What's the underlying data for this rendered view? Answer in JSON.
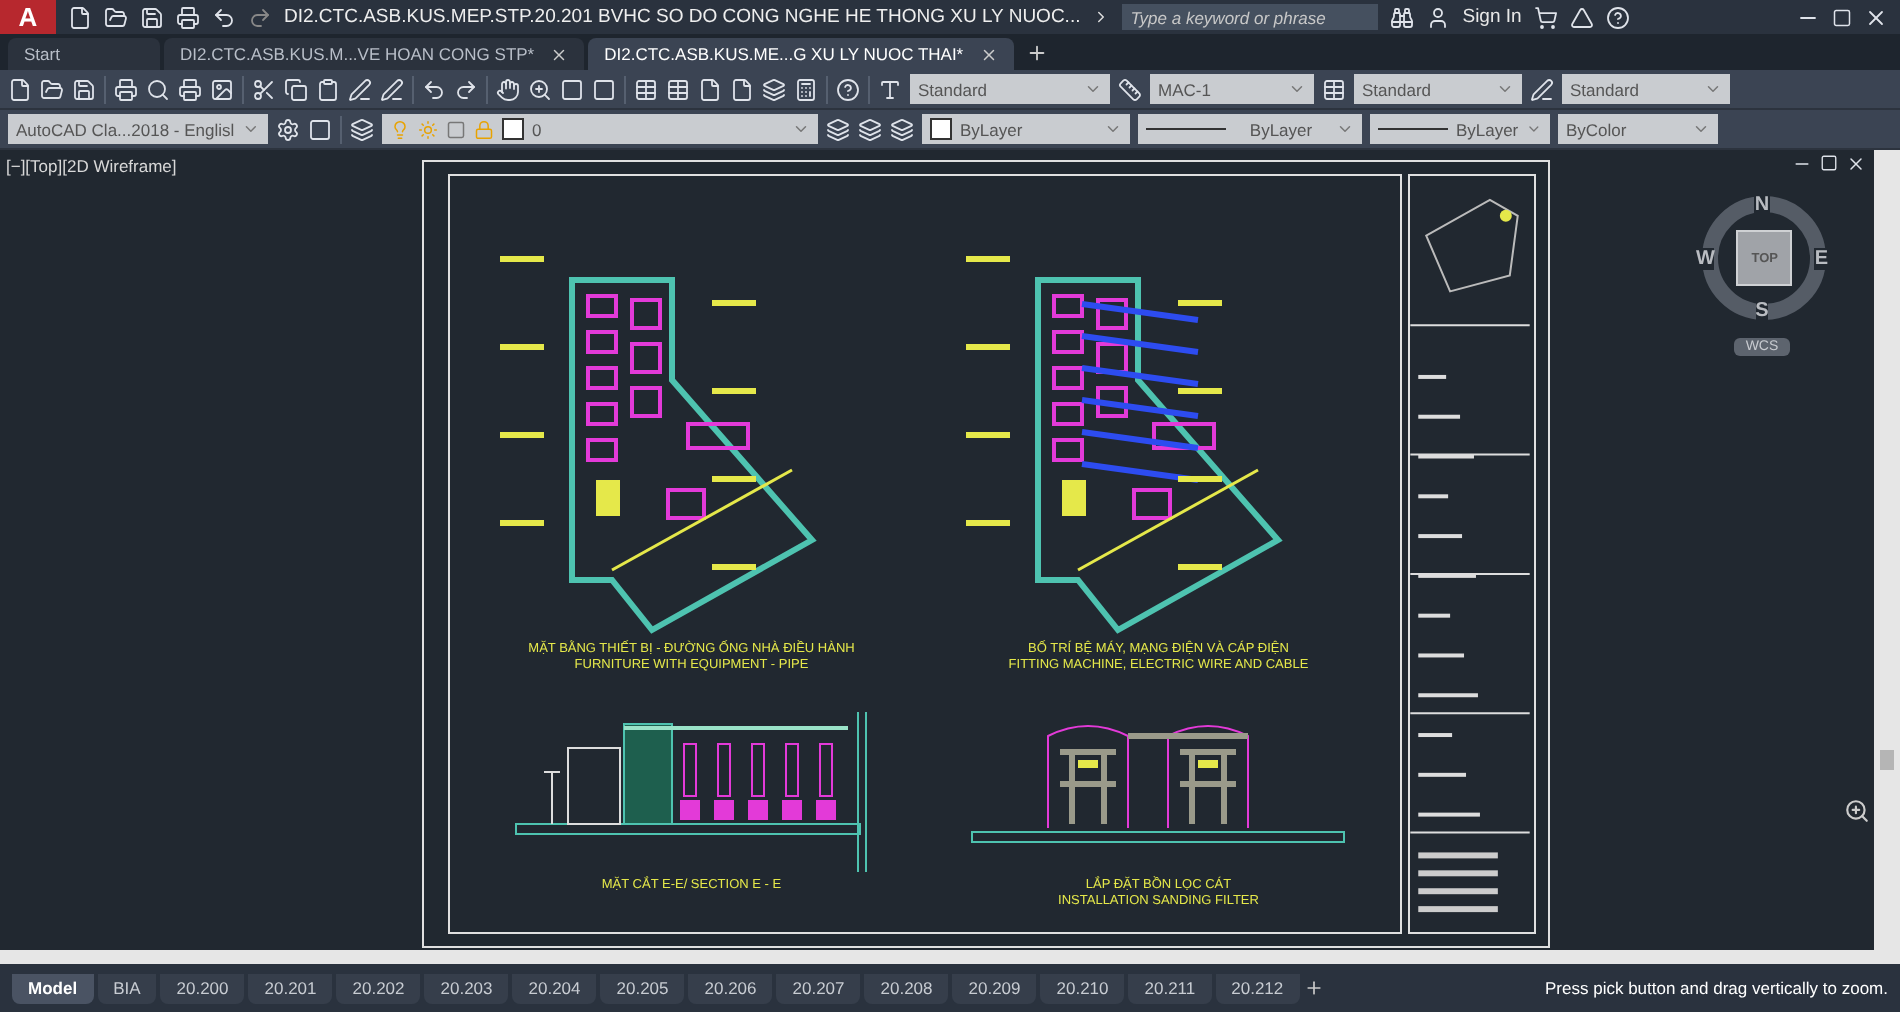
{
  "app": {
    "logo": "A",
    "title": "DI2.CTC.ASB.KUS.MEP.STP.20.201 BVHC SO DO CONG NGHE HE THONG XU LY NUOC...",
    "search": {
      "placeholder": "Type a keyword or phrase"
    },
    "sign_in": "Sign In"
  },
  "file_tabs": [
    {
      "label": "Start",
      "selected": false
    },
    {
      "label": "DI2.CTC.ASB.KUS.M...VE HOAN CONG STP*",
      "selected": false
    },
    {
      "label": "DI2.CTC.ASB.KUS.ME...G XU LY NUOC THAI*",
      "selected": true
    }
  ],
  "toolbar": {
    "text_style": "Standard",
    "dim_style": "MAC-1",
    "table_style": "Standard",
    "mleader_style": "Standard"
  },
  "properties_bar": {
    "workspace": "AutoCAD Cla...2018 - Englisl",
    "layer": "0",
    "color_value": "ByLayer",
    "linetype": "ByLayer",
    "lineweight": "ByLayer",
    "plot_style": "ByColor"
  },
  "viewport": {
    "label": "[−][Top][2D Wireframe]"
  },
  "viewcube": {
    "north": "N",
    "south": "S",
    "east": "E",
    "west": "W",
    "face": "TOP",
    "ucs": "WCS"
  },
  "drawing": {
    "captions": [
      {
        "lines": [
          "MẶT BẰNG THIẾT BỊ - ĐƯỜNG ỐNG NHÀ ĐIỀU HÀNH",
          "FURNITURE WITH EQUIPMENT - PIPE"
        ]
      },
      {
        "lines": [
          "BỐ TRÍ BỆ MÁY, MẠNG ĐIỆN VÀ CÁP ĐIỆN",
          "FITTING MACHINE, ELECTRIC WIRE AND CABLE"
        ]
      },
      {
        "lines": [
          "MẶT CẮT E-E/ SECTION E - E"
        ]
      },
      {
        "lines": [
          "LẮP ĐẶT BỒN LỌC CÁT",
          "INSTALLATION SANDING FILTER"
        ]
      }
    ]
  },
  "layout_tabs": [
    {
      "label": "Model",
      "selected": true
    },
    {
      "label": "BIA",
      "selected": false
    },
    {
      "label": "20.200",
      "selected": false
    },
    {
      "label": "20.201",
      "selected": false
    },
    {
      "label": "20.202",
      "selected": false
    },
    {
      "label": "20.203",
      "selected": false
    },
    {
      "label": "20.204",
      "selected": false
    },
    {
      "label": "20.205",
      "selected": false
    },
    {
      "label": "20.206",
      "selected": false
    },
    {
      "label": "20.207",
      "selected": false
    },
    {
      "label": "20.208",
      "selected": false
    },
    {
      "label": "20.209",
      "selected": false
    },
    {
      "label": "20.210",
      "selected": false
    },
    {
      "label": "20.211",
      "selected": false
    },
    {
      "label": "20.212",
      "selected": false
    }
  ],
  "status": "Press pick button and drag vertically to zoom."
}
